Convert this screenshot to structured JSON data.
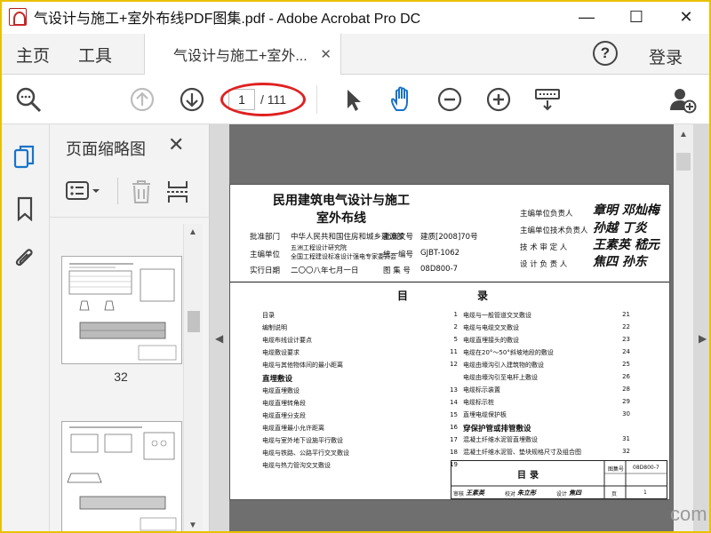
{
  "window": {
    "title": "气设计与施工+室外布线PDF图集.pdf - Adobe Acrobat Pro DC",
    "controls": {
      "minimize": "—",
      "maximize": "☐",
      "close": "✕"
    }
  },
  "tabs": {
    "home": "主页",
    "tools": "工具",
    "document": "气设计与施工+室外...",
    "close": "✕",
    "help": "?",
    "login": "登录"
  },
  "toolbar": {
    "current_page": "1",
    "total_pages": "/ 111"
  },
  "thumbnail_pane": {
    "title": "页面缩略图",
    "close": "✕",
    "thumb_label": "32"
  },
  "document": {
    "title_line1": "民用建筑电气设计与施工",
    "title_line2": "室外布线",
    "meta": {
      "approve_dept_label": "批准部门",
      "approve_dept": "中华人民共和国住房和城乡建设部",
      "approve_doc_label": "批准文号",
      "approve_doc": "建质[2008]70号",
      "editor_label": "主编单位",
      "editor_line1": "五洲工程设计研究院",
      "editor_line2": "全国工程建设标准设计强电专家委员会",
      "uniform_no_label": "统一编号",
      "uniform_no": "GJBT-1062",
      "date_label": "实行日期",
      "date": "二〇〇八年七月一日",
      "atlas_no_label": "图 集 号",
      "atlas_no": "08D800-7"
    },
    "signatures": [
      {
        "role": "主编单位负责人",
        "sign": "章明 邓灿梅"
      },
      {
        "role": "主编单位技术负责人",
        "sign": "孙越 丁炎"
      },
      {
        "role": "技 术 审 定 人",
        "sign": "王素英 嵇元"
      },
      {
        "role": "设 计 负 责 人",
        "sign": "焦四 孙东"
      }
    ],
    "toc_title": "目录",
    "toc_left": [
      {
        "text": "目录",
        "page": "1"
      },
      {
        "text": "编制说明",
        "page": "2"
      },
      {
        "text": "电缆布线设计要点",
        "page": "5"
      },
      {
        "text": "电缆敷设要求",
        "page": "11"
      },
      {
        "text": "电缆与其他物体间的最小距离",
        "page": "12"
      }
    ],
    "toc_left_section": "直埋敷设",
    "toc_left2": [
      {
        "text": "电缆直埋敷设",
        "page": "13"
      },
      {
        "text": "电缆直埋转角段",
        "page": "14"
      },
      {
        "text": "电缆直埋分支段",
        "page": "15"
      },
      {
        "text": "电缆直埋最小允许距离",
        "page": "16"
      },
      {
        "text": "电缆与室外地下设施平行敷设",
        "page": "17"
      },
      {
        "text": "电缆与铁路、公路平行交叉敷设",
        "page": "18"
      },
      {
        "text": "电缆与热力管沟交叉敷设",
        "page": "19"
      }
    ],
    "toc_right": [
      {
        "text": "电缆与一般管道交叉敷设",
        "page": "21"
      },
      {
        "text": "电缆与电缆交叉敷设",
        "page": "22"
      },
      {
        "text": "电缆直埋接头的敷设",
        "page": "23"
      },
      {
        "text": "电缆在20°～50°斜坡地段的敷设",
        "page": "24"
      },
      {
        "text": "电缆由壕沟引入建筑物的敷设",
        "page": "25"
      },
      {
        "text": "电缆由壕沟引至电杆上敷设",
        "page": "26"
      },
      {
        "text": "电缆标示装置",
        "page": "28"
      },
      {
        "text": "电缆标示桩",
        "page": "29"
      },
      {
        "text": "直埋电缆保护板",
        "page": "30"
      }
    ],
    "toc_right_section": "穿保护管或排管敷设",
    "toc_right2": [
      {
        "text": "混凝土纤维水泥管直埋敷设",
        "page": "31"
      },
      {
        "text": "混凝土纤维水泥管、垫块规格尺寸及组合图",
        "page": "32"
      }
    ],
    "titleblock": {
      "name": "目录",
      "atlas_label": "图集号",
      "atlas_no": "08D800-7",
      "review": "审核",
      "reviewer": "王素英",
      "check": "校对",
      "checker": "朱立彤",
      "design": "设计",
      "designer": "焦四",
      "page_label": "页",
      "page_no": "1"
    }
  },
  "watermark": "com"
}
